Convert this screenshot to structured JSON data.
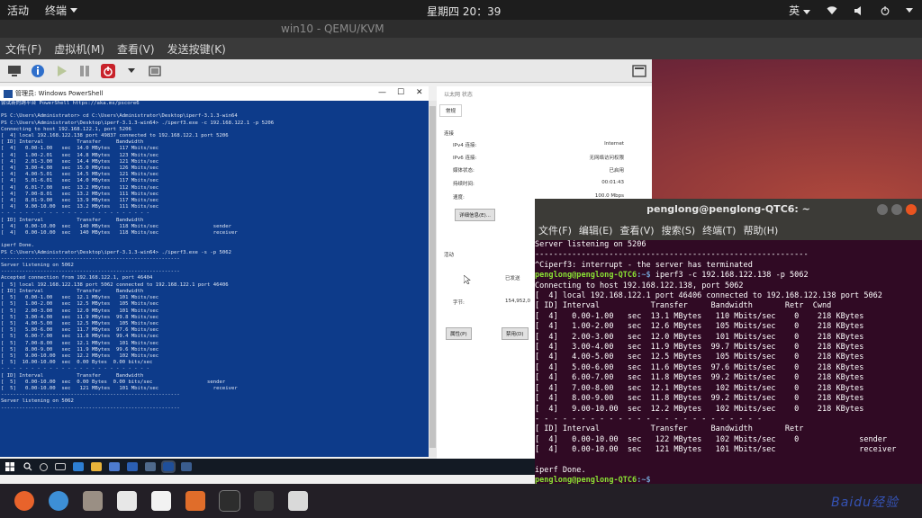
{
  "topbar": {
    "activities": "活动",
    "app_menu": "终端",
    "clock": "星期四 20：39",
    "input_method": "英"
  },
  "vm_window": {
    "title": "win10 - QEMU/KVM",
    "menu": [
      "文件(F)",
      "虚拟机(M)",
      "查看(V)",
      "发送按键(K)"
    ]
  },
  "powershell": {
    "title": "管理员: Windows PowerShell",
    "lines": [
      "尝试新的跨平台 PowerShell https://aka.ms/pscore6",
      "",
      "PS C:\\Users\\Administrator> cd C:\\Users\\Administrator\\Desktop\\iperf-3.1.3-win64",
      "PS C:\\Users\\Administrator\\Desktop\\iperf-3.1.3-win64> ./iperf3.exe -c 192.168.122.1 -p 5206",
      "Connecting to host 192.168.122.1, port 5206",
      "[  4] local 192.168.122.138 port 49837 connected to 192.168.122.1 port 5206",
      "[ ID] Interval           Transfer     Bandwidth",
      "[  4]   0.00-1.00   sec  14.0 MBytes   117 Mbits/sec",
      "[  4]   1.00-2.01   sec  14.8 MBytes   123 Mbits/sec",
      "[  4]   2.01-3.00   sec  14.4 MBytes   121 Mbits/sec",
      "[  4]   3.00-4.00   sec  15.0 MBytes   126 Mbits/sec",
      "[  4]   4.00-5.01   sec  14.5 MBytes   121 Mbits/sec",
      "[  4]   5.01-6.01   sec  14.0 MBytes   117 Mbits/sec",
      "[  4]   6.01-7.00   sec  13.2 MBytes   112 Mbits/sec",
      "[  4]   7.00-8.01   sec  13.2 MBytes   111 Mbits/sec",
      "[  4]   8.01-9.00   sec  13.9 MBytes   117 Mbits/sec",
      "[  4]   9.00-10.00  sec  13.2 MBytes   111 Mbits/sec",
      "- - - - - - - - - - - - - - - - - - - - - - - - -",
      "[ ID] Interval           Transfer     Bandwidth",
      "[  4]   0.00-10.00  sec   140 MBytes   118 Mbits/sec                  sender",
      "[  4]   0.00-10.00  sec   140 MBytes   118 Mbits/sec                  receiver",
      "",
      "iperf Done.",
      "PS C:\\Users\\Administrator\\Desktop\\iperf-3.1.3-win64> ./iperf3.exe -s -p 5062",
      "-----------------------------------------------------------",
      "Server listening on 5062",
      "-----------------------------------------------------------",
      "Accepted connection from 192.168.122.1, port 46404",
      "[  5] local 192.168.122.138 port 5062 connected to 192.168.122.1 port 46406",
      "[ ID] Interval           Transfer     Bandwidth",
      "[  5]   0.00-1.00   sec  12.1 MBytes   101 Mbits/sec",
      "[  5]   1.00-2.00   sec  12.5 MBytes   105 Mbits/sec",
      "[  5]   2.00-3.00   sec  12.0 MBytes   101 Mbits/sec",
      "[  5]   3.00-4.00   sec  11.9 MBytes  99.8 Mbits/sec",
      "[  5]   4.00-5.00   sec  12.5 MBytes   105 Mbits/sec",
      "[  5]   5.00-6.00   sec  11.7 MBytes  97.6 Mbits/sec",
      "[  5]   6.00-7.00   sec  11.8 MBytes  99.4 Mbits/sec",
      "[  5]   7.00-8.00   sec  12.1 MBytes   101 Mbits/sec",
      "[  5]   8.00-9.00   sec  11.9 MBytes  99.6 Mbits/sec",
      "[  5]   9.00-10.00  sec  12.2 MBytes   102 Mbits/sec",
      "[  5]  10.00-10.00  sec  0.00 Bytes  0.00 bits/sec",
      "- - - - - - - - - - - - - - - - - - - - - - - - -",
      "[ ID] Interval           Transfer     Bandwidth",
      "[  5]   0.00-10.00  sec  0.00 Bytes  0.00 bits/sec                  sender",
      "[  5]   0.00-10.00  sec   121 MBytes   101 Mbits/sec                  receiver",
      "-----------------------------------------------------------",
      "Server listening on 5062",
      "-----------------------------------------------------------"
    ]
  },
  "ethernet_status": {
    "title": "以太网 状态",
    "tab": "常规",
    "connection_section": "连接",
    "rows": [
      {
        "label": "IPv4 连接:",
        "value": "Internet"
      },
      {
        "label": "IPv6 连接:",
        "value": "无网络访问权限"
      },
      {
        "label": "媒体状态:",
        "value": "已启用"
      },
      {
        "label": "持续时间:",
        "value": "00:01:43"
      },
      {
        "label": "速度:",
        "value": "100.0 Mbps"
      }
    ],
    "details_button": "详细信息(E)...",
    "activity_section": "活动",
    "sent_label": "已发送",
    "bytes_label": "字节:",
    "bytes_value": "154,952,0",
    "properties_button": "属性(P)",
    "disable_button": "禁用(D)"
  },
  "terminal": {
    "title": "penglong@penglong-QTC6: ~",
    "menu": [
      "文件(F)",
      "编辑(E)",
      "查看(V)",
      "搜索(S)",
      "终端(T)",
      "帮助(H)"
    ],
    "prompt_user": "penglong@penglong-QTC6",
    "prompt_path": ":~$",
    "line_server_listening": "Server listening on 5206",
    "line_sep_dash": "-----------------------------------------------------------",
    "line_interrupt": "^Ciperf3: interrupt - the server has terminated",
    "command": " iperf3 -c 192.168.122.138 -p 5062",
    "lines": [
      "Connecting to host 192.168.122.138, port 5062",
      "[  4] local 192.168.122.1 port 46406 connected to 192.168.122.138 port 5062",
      "[ ID] Interval           Transfer     Bandwidth       Retr  Cwnd",
      "[  4]   0.00-1.00   sec  13.1 MBytes   110 Mbits/sec    0    218 KBytes",
      "[  4]   1.00-2.00   sec  12.6 MBytes   105 Mbits/sec    0    218 KBytes",
      "[  4]   2.00-3.00   sec  12.0 MBytes   101 Mbits/sec    0    218 KBytes",
      "[  4]   3.00-4.00   sec  11.9 MBytes  99.7 Mbits/sec    0    218 KBytes",
      "[  4]   4.00-5.00   sec  12.5 MBytes   105 Mbits/sec    0    218 KBytes",
      "[  4]   5.00-6.00   sec  11.6 MBytes  97.6 Mbits/sec    0    218 KBytes",
      "[  4]   6.00-7.00   sec  11.8 MBytes  99.2 Mbits/sec    0    218 KBytes",
      "[  4]   7.00-8.00   sec  12.1 MBytes   102 Mbits/sec    0    218 KBytes",
      "[  4]   8.00-9.00   sec  11.8 MBytes  99.2 Mbits/sec    0    218 KBytes",
      "[  4]   9.00-10.00  sec  12.2 MBytes   102 Mbits/sec    0    218 KBytes",
      "- - - - - - - - - - - - - - - - - - - - - - - - -",
      "[ ID] Interval           Transfer     Bandwidth       Retr",
      "[  4]   0.00-10.00  sec   122 MBytes   102 Mbits/sec    0             sender",
      "[  4]   0.00-10.00  sec   121 MBytes   101 Mbits/sec                  receiver",
      "",
      "iperf Done."
    ]
  },
  "watermark": "Baidu经验",
  "colors": {
    "powershell_bg": "#0d3b8a",
    "terminal_bg": "#300a24",
    "prompt_green": "#8ae234",
    "prompt_blue": "#729fcf"
  }
}
